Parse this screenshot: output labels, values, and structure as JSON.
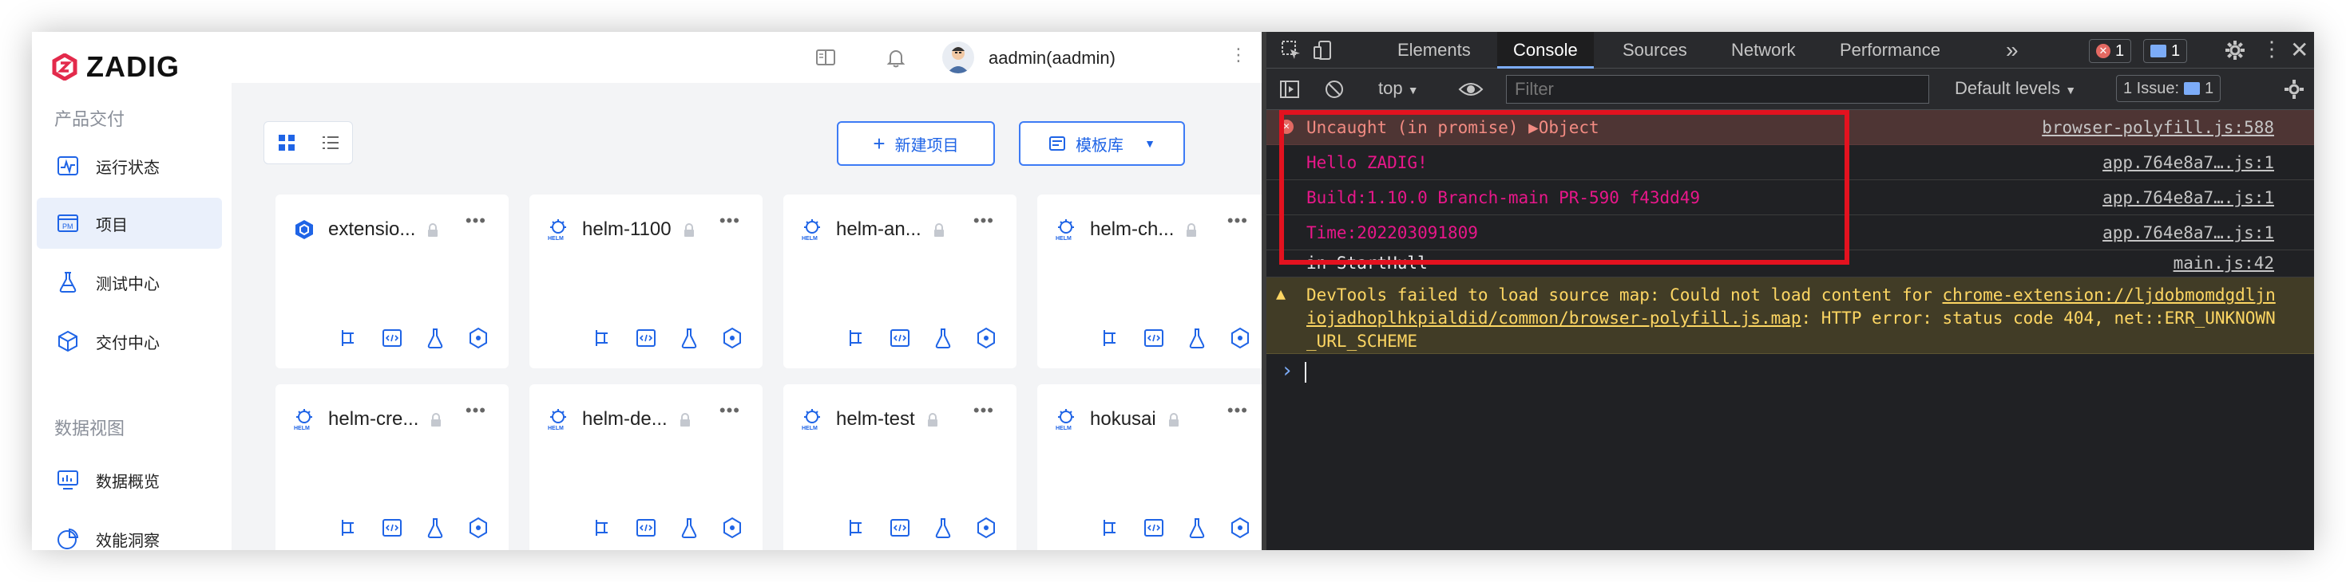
{
  "app": {
    "logo_text": "ZADIG",
    "sidebar": {
      "groups": [
        {
          "title": "产品交付"
        },
        {
          "title": "数据视图"
        }
      ],
      "items": [
        {
          "label": "运行状态",
          "icon": "activity-icon"
        },
        {
          "label": "项目",
          "icon": "pm-icon"
        },
        {
          "label": "测试中心",
          "icon": "flask-icon"
        },
        {
          "label": "交付中心",
          "icon": "package-icon"
        },
        {
          "label": "数据概览",
          "icon": "dashboard-icon"
        },
        {
          "label": "效能洞察",
          "icon": "pie-chart-icon"
        }
      ]
    },
    "header": {
      "user": "aadmin(aadmin)"
    },
    "toolbar": {
      "new_project": "新建项目",
      "template_lib": "模板库"
    },
    "projects": [
      {
        "name": "extensio...",
        "type": "extension"
      },
      {
        "name": "helm-1100",
        "type": "helm"
      },
      {
        "name": "helm-an...",
        "type": "helm"
      },
      {
        "name": "helm-ch...",
        "type": "helm"
      },
      {
        "name": "helm-cre...",
        "type": "helm"
      },
      {
        "name": "helm-de...",
        "type": "helm"
      },
      {
        "name": "helm-test",
        "type": "helm"
      },
      {
        "name": "hokusai",
        "type": "helm"
      }
    ],
    "more_label": "•••",
    "helm_badge": "HELM"
  },
  "devtools": {
    "tabs": [
      "Elements",
      "Console",
      "Sources",
      "Network",
      "Performance"
    ],
    "active_tab": "Console",
    "overflow": "»",
    "error_count": "1",
    "info_count": "1",
    "context": "top",
    "filter_placeholder": "Filter",
    "levels": "Default levels",
    "issues": "1 Issue:",
    "issues_count": "1",
    "console": [
      {
        "level": "error",
        "msg": "Uncaught (in promise) ▶Object",
        "src": "browser-polyfill.js:588"
      },
      {
        "level": "log-pink",
        "msg": "Hello ZADIG!",
        "src": "app.764e8a7….js:1"
      },
      {
        "level": "log-pink",
        "msg": "Build:1.10.0 Branch-main PR-590 f43dd49",
        "src": "app.764e8a7….js:1"
      },
      {
        "level": "log-pink",
        "msg": "Time:202203091809",
        "src": "app.764e8a7….js:1"
      },
      {
        "level": "log",
        "msg": "in StartHull",
        "src": "main.js:42"
      }
    ],
    "warning": {
      "prefix": "DevTools failed to load source map: Could not load content for ",
      "link": "chrome-extension://ljdobmomdgdljniojadhoplhkpialdid/common/browser-polyfill.js.map",
      "suffix": ": HTTP error: status code 404, net::ERR_UNKNOWN_URL_SCHEME"
    },
    "prompt": "›"
  },
  "colors": {
    "accent": "#1f64e6",
    "error": "#f28b82",
    "pink": "#e8178a",
    "warning": "#fdd663",
    "highlight": "#e3121f"
  }
}
